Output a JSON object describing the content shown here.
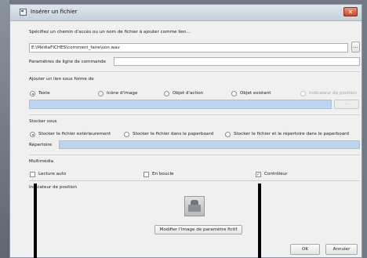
{
  "dialog": {
    "title": "Insérer un fichier",
    "close_symbol": "✕"
  },
  "path_section": {
    "label": "Spécifiez un chemin d'accès ou un nom de fichier à ajouter comme lien...",
    "path_value": "E:\\MediaFICHES\\comment_faire\\son.wav",
    "browse_symbol": "…"
  },
  "params": {
    "label": "Paramètres de ligne de commande",
    "value": ""
  },
  "link_as": {
    "label": "Ajouter un lien sous forme de",
    "options": [
      "Texte",
      "Icône d'image",
      "Objet d'action",
      "Objet existant",
      "Indicateur de position"
    ],
    "selected": "Texte",
    "button_label": "..."
  },
  "store": {
    "label": "Stocker sous",
    "options": [
      "Stocker le fichier extérieurement",
      "Stocker le fichier dans le paperboard",
      "Stocker le fichier et le répertoire dans le paperboard"
    ],
    "selected": "Stocker le fichier extérieurement",
    "directory_label": "Répertoire",
    "directory_value": ""
  },
  "multimedia": {
    "label": "Multimédia",
    "autoplay": {
      "label": "Lecture auto",
      "checked": false
    },
    "loop": {
      "label": "En boucle",
      "checked": false
    },
    "controller": {
      "label": "Contrôleur",
      "checked": true,
      "mark": "✓"
    }
  },
  "placeholder": {
    "label": "Indicateur de position",
    "edit_button": "Modifier l'image de paramètre fictif"
  },
  "footer": {
    "ok_label": "OK",
    "cancel_label": "Annuler"
  }
}
